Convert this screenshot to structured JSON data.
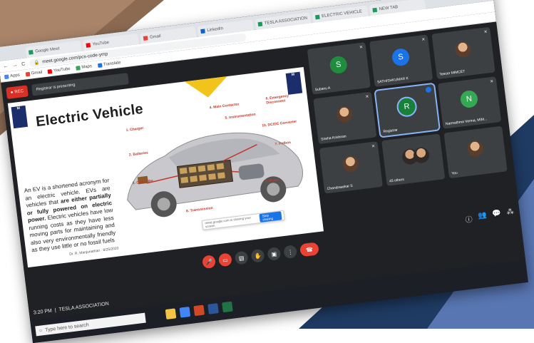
{
  "browser": {
    "tabs": [
      "Google Meet",
      "YouTube",
      "Gmail",
      "LinkedIn",
      "TESLA ASSOCIATION",
      "ELECTRIC VEHICLE",
      "NEW TAB"
    ],
    "url": "meet.google.com/pcs-code-ymp",
    "bookmarks": [
      "Apps",
      "Gmail",
      "YouTube",
      "Maps",
      "Translate"
    ]
  },
  "meet": {
    "rec_label": "REC",
    "recording_note": "Registrar is presenting",
    "slide": {
      "title": "Electric Vehicle",
      "body_1": "An EV is a shortened acronym for an electric vehicle. EVs are vehicles that",
      "body_bold_1": "are either partially or fully powered on electric power.",
      "body_2": "Electric vehicles have low running costs as they have less moving parts for maintaining and also very environmentally friendly as they use little or no fossil fuels",
      "callouts": [
        "1. Charger",
        "2. Batteries",
        "3. Controller",
        "4. Main Contactor",
        "5. Instrumentation",
        "6. Emergency Disconnect",
        "7. Potbox",
        "8. Transmission",
        "9. Motor",
        "10. DC/DC Converter"
      ],
      "footer": "Dr. R. Manjunathan · 8/25/2020",
      "share_dialog": "meet.google.com is sharing your screen",
      "share_button": "Stop sharing"
    },
    "participants": [
      {
        "name": "Subanu A",
        "initial": "S",
        "color": "#1e8e3e"
      },
      {
        "name": "SATHISHKUMAR K",
        "initial": "S",
        "color": "#1a73e8"
      },
      {
        "name": "Teecer MIMCET",
        "initial": "",
        "color": ""
      },
      {
        "name": "Sneha Krishnan",
        "initial": "",
        "color": ""
      },
      {
        "name": "Registrar",
        "initial": "R",
        "color": "#188038"
      },
      {
        "name": "Narmathma Verma, MIM...",
        "initial": "N",
        "color": "#34a853"
      },
      {
        "name": "Chandrasekar S",
        "initial": "",
        "color": ""
      },
      {
        "name": "45 others",
        "initial": "",
        "color": ""
      },
      {
        "name": "You",
        "initial": "",
        "color": ""
      }
    ],
    "meeting_time": "3:20 PM",
    "meeting_name": "TESLA ASSOCIATION"
  },
  "taskbar": {
    "search_placeholder": "Type here to search"
  }
}
